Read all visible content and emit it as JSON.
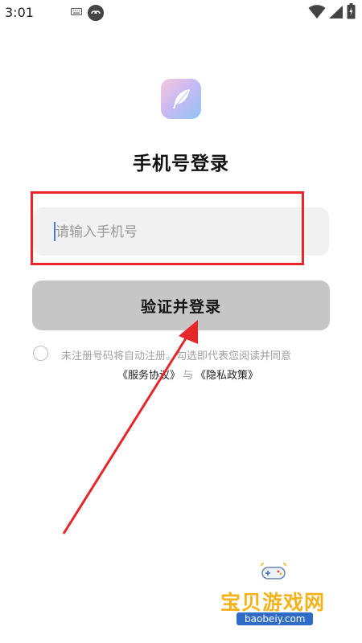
{
  "status_bar": {
    "time": "3:01",
    "icons": [
      "keyboard-icon",
      "app-badge-icon",
      "wifi-icon",
      "signal-icon",
      "battery-icon"
    ]
  },
  "logo": {
    "icon": "feather-icon"
  },
  "title": "手机号登录",
  "phone_input": {
    "placeholder": "请输入手机号",
    "value": ""
  },
  "submit_button": {
    "label": "验证并登录"
  },
  "agreement": {
    "checked": false,
    "text": "未注册号码将自动注册。勾选即代表您阅读并同意",
    "service_link": "《服务协议》",
    "conjunction": "与",
    "privacy_link": "《隐私政策》"
  },
  "annotation": {
    "highlight_color": "#e7262b",
    "arrow_color": "#e7262b"
  },
  "watermark": {
    "brand": "宝贝游戏网",
    "url": "baobeiy.com"
  },
  "colors": {
    "button_bg": "#c6c6c6",
    "input_bg": "#f1f1f1",
    "caret": "#3b7cf2"
  }
}
